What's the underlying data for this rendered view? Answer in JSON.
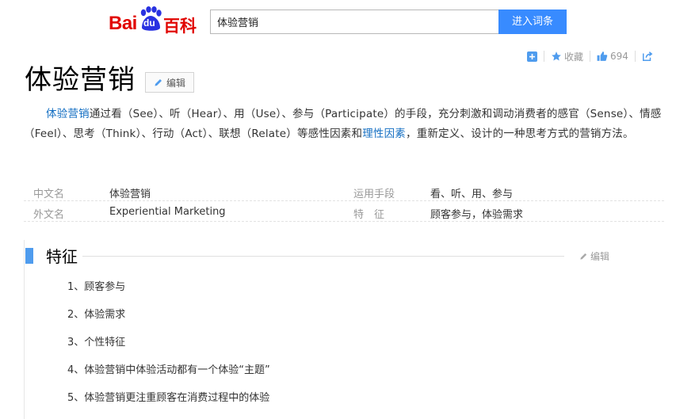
{
  "header": {
    "logo": {
      "part1": "Bai",
      "part2": "du",
      "part3": "百科"
    },
    "search_value": "体验营销",
    "search_button": "进入词条"
  },
  "toolbar": {
    "collect_label": "收藏",
    "like_count": "694"
  },
  "page": {
    "title": "体验营销",
    "edit_label": "编辑"
  },
  "summary": {
    "link1": "体验营销",
    "text1": "通过看（See）、听（Hear）、用（Use）、参与（Participate）的手段，充分刺激和调动消费者的感官（Sense）、情感（Feel）、思考（Think）、行动（Act）、联想（Relate）等感性因素和",
    "link2": "理性因素",
    "text2": "，重新定义、设计的一种思考方式的营销方法。"
  },
  "info": [
    {
      "k1": "中文名",
      "v1": "体验营销",
      "k2": "运用手段",
      "v2": "看、听、用、参与"
    },
    {
      "k1": "外文名",
      "v1": "Experiential Marketing",
      "k2": "特　征",
      "v2": "顾客参与，体验需求"
    }
  ],
  "section": {
    "title": "特征",
    "edit_label": "编辑",
    "items": [
      "1、顾客参与",
      "2、体验需求",
      "3、个性特征",
      "4、体验营销中体验活动都有一个体验“主题”",
      "5、体验营销更注重顾客在消费过程中的体验"
    ]
  },
  "colors": {
    "brand_red": "#e10602",
    "brand_blue": "#2932e1",
    "button_blue": "#388bff",
    "link_blue": "#136ec2",
    "section_bar": "#4f9cee"
  }
}
